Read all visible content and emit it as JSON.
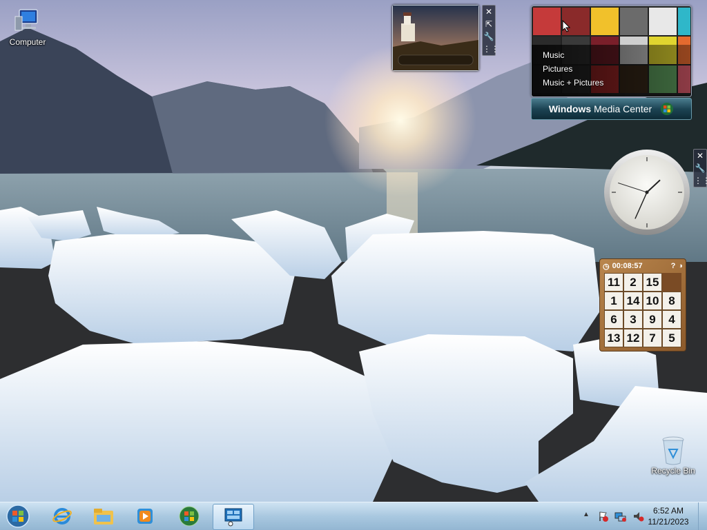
{
  "desktop": {
    "icons": [
      {
        "label": "Computer",
        "icon": "computer-icon"
      },
      {
        "label": "Recycle Bin",
        "icon": "recycle-bin-icon"
      }
    ]
  },
  "gadgets": {
    "slideshow": {
      "icon": "lighthouse-photo"
    },
    "media_center": {
      "menu": [
        "Music",
        "Pictures",
        "Music + Pictures"
      ],
      "brand_bold": "Windows",
      "brand_rest": "Media Center"
    },
    "clock": {
      "hour": 1,
      "minute": 34,
      "second": 48
    },
    "puzzle": {
      "timer": "00:08:57",
      "grid": [
        [
          11,
          2,
          15,
          null
        ],
        [
          1,
          14,
          10,
          8
        ],
        [
          6,
          3,
          9,
          4
        ],
        [
          13,
          12,
          7,
          5
        ]
      ]
    }
  },
  "taskbar": {
    "pinned": [
      "start-orb-icon",
      "internet-explorer-icon",
      "file-explorer-icon",
      "media-player-icon",
      "media-center-icon",
      "gadgets-icon"
    ],
    "clock_time": "6:52 AM",
    "clock_date": "11/21/2023"
  },
  "colors": {
    "accent": "#2b6ea8",
    "taskbar": "#a9c8e0"
  }
}
